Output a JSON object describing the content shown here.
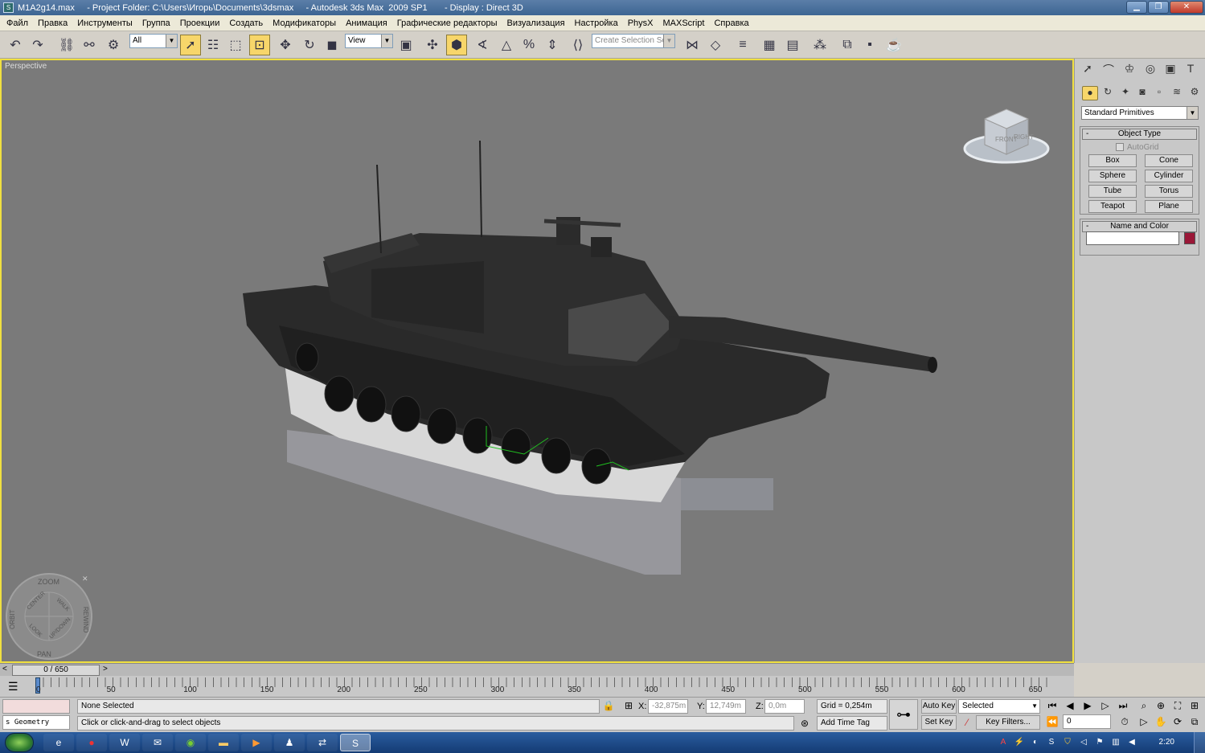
{
  "window": {
    "title": "M1A2g14.max     - Project Folder: C:\\Users\\Игорь\\Documents\\3dsmax     - Autodesk 3ds Max  2009 SP1       - Display : Direct 3D",
    "minimize": "▁",
    "maximize": "❐",
    "close": "✕"
  },
  "menu": [
    "Файл",
    "Правка",
    "Инструменты",
    "Группа",
    "Проекции",
    "Создать",
    "Модификаторы",
    "Анимация",
    "Графические редакторы",
    "Визуализация",
    "Настройка",
    "PhysX",
    "MAXScript",
    "Справка"
  ],
  "toolbar": {
    "selection_filter": "All",
    "ref_coord": "View",
    "named_selection_placeholder": "Create Selection Set",
    "icons": [
      "undo-icon",
      "redo-icon",
      "select-link-icon",
      "unlink-icon",
      "bind-spacewarp-icon",
      "select-object-icon",
      "select-by-name-icon",
      "rect-region-icon",
      "window-crossing-icon",
      "move-icon",
      "rotate-icon",
      "scale-icon",
      "pivot-icon",
      "manipulate-icon",
      "keyboard-shortcut-icon",
      "snap-3d-icon",
      "angle-snap-icon",
      "percent-snap-icon",
      "spinner-snap-icon",
      "edit-named-sel-icon",
      "mirror-icon",
      "align-icon",
      "layer-manager-icon",
      "curve-editor-icon",
      "schematic-icon",
      "material-editor-icon",
      "render-setup-icon",
      "rendered-frame-icon",
      "quick-render-icon"
    ]
  },
  "viewport": {
    "label": "Perspective",
    "bg_color": "#7a7a7a",
    "border_color": "#f0e040",
    "viewcube": {
      "front": "FRONT",
      "right": "RIGHT"
    },
    "steering_wheel": {
      "zoom": "ZOOM",
      "orbit": "ORBIT",
      "center": "CENTER",
      "walk": "WALK",
      "rewind": "REWIND",
      "look": "LOOK",
      "updown": "UP/DOWN",
      "pan": "PAN",
      "close": "✕"
    }
  },
  "command_panel": {
    "tab_icons": [
      "create-tab-icon",
      "modify-tab-icon",
      "hierarchy-tab-icon",
      "motion-tab-icon",
      "display-tab-icon",
      "utilities-tab-icon"
    ],
    "sub_icons": [
      "geometry-icon",
      "shapes-icon",
      "lights-icon",
      "cameras-icon",
      "helpers-icon",
      "spacewarps-icon",
      "systems-icon"
    ],
    "category": "Standard Primitives",
    "object_type": {
      "header": "Object Type",
      "autogrid": "AutoGrid",
      "buttons": [
        "Box",
        "Cone",
        "Sphere",
        "Cylinder",
        "Tube",
        "Torus",
        "Teapot",
        "Plane"
      ]
    },
    "name_and_color": {
      "header": "Name and Color",
      "name_value": "",
      "color": "#9a1737"
    }
  },
  "timeline": {
    "slider_label": "0 / 650",
    "prev": "<",
    "next": ">",
    "ticks": [
      "0",
      "50",
      "100",
      "150",
      "200",
      "250",
      "300",
      "350",
      "400",
      "450",
      "500",
      "550",
      "600",
      "650"
    ]
  },
  "status": {
    "maxscript_listener": "",
    "maxscript_mini": "s Geometry",
    "selection_status": "None Selected",
    "prompt": "Click or click-and-drag to select objects",
    "x_label": "X:",
    "x_value": "-32,875m",
    "y_label": "Y:",
    "y_value": "12,749m",
    "z_label": "Z:",
    "z_value": "0,0m",
    "grid": "Grid = 0,254m",
    "add_time_tag": "Add Time Tag",
    "auto_key": "Auto Key",
    "set_key": "Set Key",
    "selected_dd": "Selected",
    "key_filters": "Key Filters...",
    "frame_value": "0"
  },
  "taskbar": {
    "apps": [
      "opera",
      "word",
      "outlook",
      "chrome",
      "explorer",
      "media",
      "people",
      "network",
      "3dsmax"
    ],
    "clock": "2:20"
  }
}
